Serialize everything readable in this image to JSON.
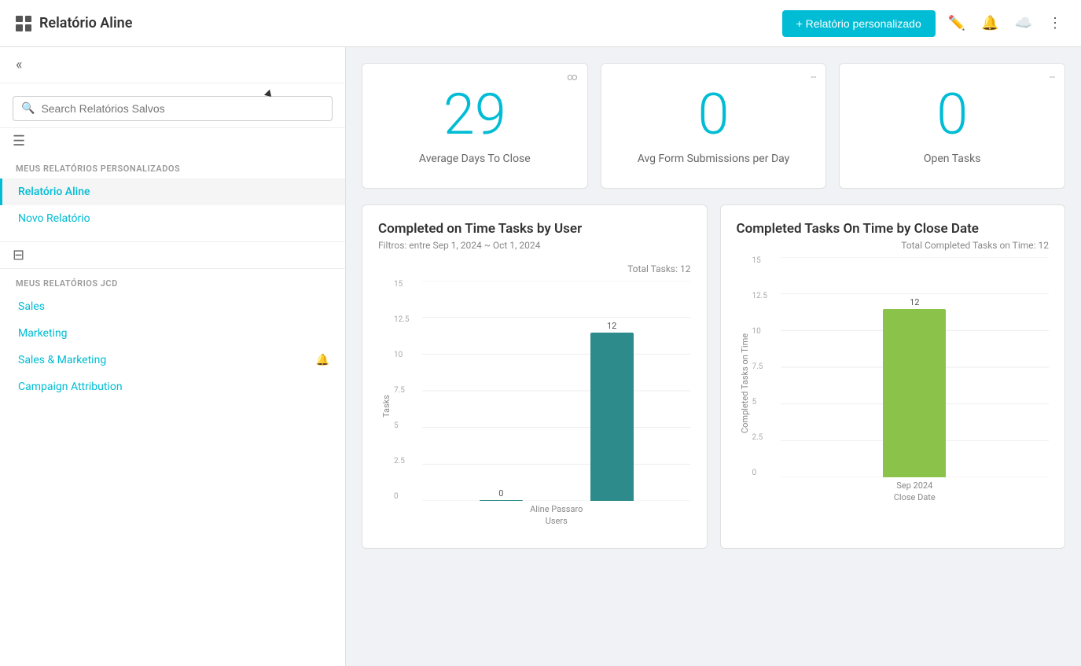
{
  "topbar": {
    "title": "Relatório Aline",
    "new_report_label": "+ Relatório personalizado",
    "menu_dots": "⋮"
  },
  "sidebar": {
    "search_placeholder": "Search Relatórios Salvos",
    "my_reports_label": "Meus relatórios personalizados",
    "my_reports": [
      {
        "label": "Relatório Aline",
        "active": true
      },
      {
        "label": "Novo Relatório",
        "active": false
      }
    ],
    "jcd_section_label": "MEUS RELATÓRIOS JCD",
    "jcd_reports": [
      {
        "label": "Sales",
        "has_bell": false
      },
      {
        "label": "Marketing",
        "has_bell": false
      },
      {
        "label": "Sales & Marketing",
        "has_bell": true
      },
      {
        "label": "Campaign Attribution",
        "has_bell": false
      }
    ]
  },
  "stat_cards": [
    {
      "value": "29",
      "label": "Average Days To Close",
      "menu": "∞"
    },
    {
      "value": "0",
      "label": "Avg Form Submissions per Day",
      "menu": "--"
    },
    {
      "value": "0",
      "label": "Open Tasks",
      "menu": "--"
    }
  ],
  "chart1": {
    "title": "Completed on Time Tasks by User",
    "subtitle": "Filtros: entre Sep 1, 2024 ~ Oct 1, 2024",
    "total_label": "Total Tasks: 12",
    "y_axis_label": "Tasks",
    "x_axis_label": "Users",
    "y_ticks": [
      "15",
      "12.5",
      "10",
      "7.5",
      "5",
      "2.5",
      "0"
    ],
    "bars": [
      {
        "label": "Aline Passaro",
        "value": 0,
        "bar_label": "0",
        "color": "#4aa8a8",
        "height_pct": 0
      },
      {
        "label": "Aline Passaro",
        "value": 12,
        "bar_label": "12",
        "color": "#2e8b8b",
        "height_pct": 80
      }
    ]
  },
  "chart2": {
    "title": "Completed Tasks On Time by Close Date",
    "total_label": "Total Completed Tasks on Time: 12",
    "y_axis_label": "Completed Tasks on Time",
    "x_axis_label": "Close Date",
    "y_ticks": [
      "15",
      "12.5",
      "10",
      "7.5",
      "5",
      "2.5",
      "0"
    ],
    "bars": [
      {
        "label": "Sep 2024",
        "value": 12,
        "bar_label": "12",
        "color": "#8bc34a",
        "height_pct": 80
      }
    ]
  },
  "colors": {
    "accent": "#00bcd4",
    "bar1": "#2e8b8b",
    "bar2": "#8bc34a"
  }
}
